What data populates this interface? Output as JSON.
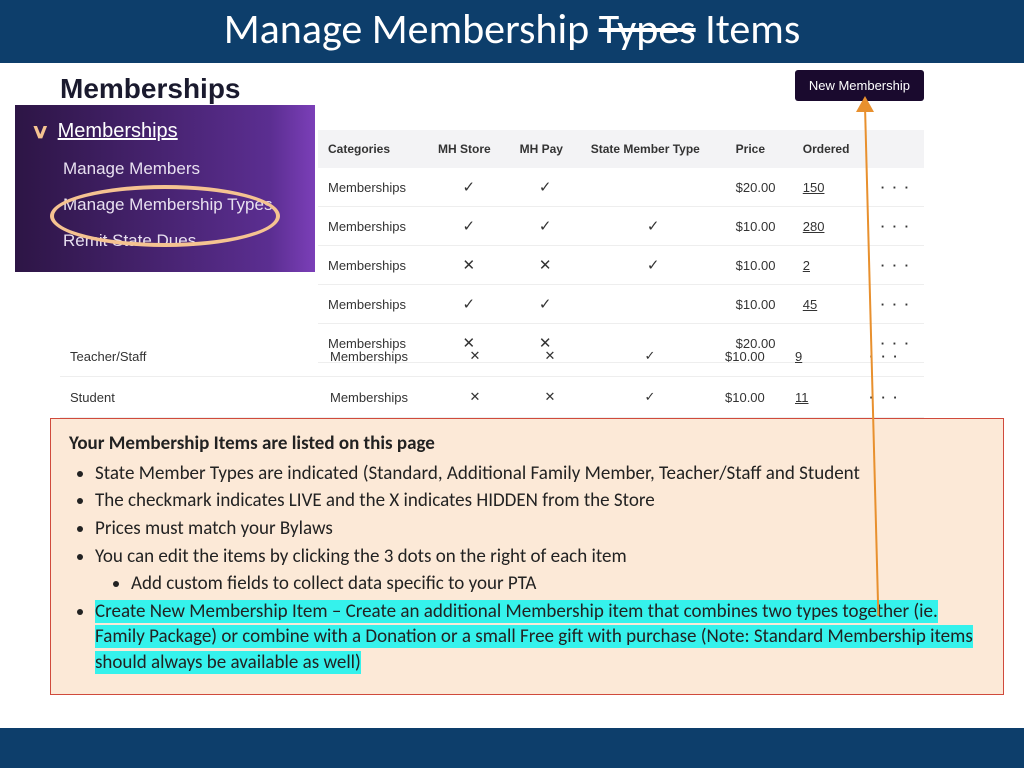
{
  "banner": {
    "prefix": "Manage Membership ",
    "strike": "Types",
    "suffix": " Items"
  },
  "app": {
    "title": "Memberships",
    "new_btn": "New Membership"
  },
  "sidebar": {
    "heading": "Memberships",
    "items": [
      "Manage Members",
      "Manage Membership Types",
      "Remit State Dues"
    ]
  },
  "table": {
    "headers": [
      "Categories",
      "MH Store",
      "MH Pay",
      "State Member Type",
      "Price",
      "Ordered"
    ],
    "rows": [
      {
        "cat": "Memberships",
        "store": "check",
        "pay": "check",
        "state": "",
        "price": "$20.00",
        "ordered": "150"
      },
      {
        "cat": "Memberships",
        "store": "check",
        "pay": "check",
        "state": "check",
        "price": "$10.00",
        "ordered": "280"
      },
      {
        "cat": "Memberships",
        "store": "x",
        "pay": "x",
        "state": "check",
        "price": "$10.00",
        "ordered": "2"
      },
      {
        "cat": "Memberships",
        "store": "check",
        "pay": "check",
        "state": "",
        "price": "$10.00",
        "ordered": "45"
      },
      {
        "cat": "Memberships",
        "store": "x",
        "pay": "x",
        "state": "",
        "price": "$20.00",
        "ordered": ""
      }
    ],
    "lower_rows": [
      {
        "name": "Teacher/Staff",
        "cat": "Memberships",
        "store": "x",
        "pay": "x",
        "state": "check",
        "price": "$10.00",
        "ordered": "9"
      },
      {
        "name": "Student",
        "cat": "Memberships",
        "store": "x",
        "pay": "x",
        "state": "check",
        "price": "$10.00",
        "ordered": "11"
      }
    ]
  },
  "icons": {
    "check": "✓",
    "x": "✕",
    "dots": "· · ·"
  },
  "notes": {
    "title": "Your Membership Items are listed on this page",
    "b1": "State Member Types are indicated (Standard, Additional Family Member, Teacher/Staff and Student",
    "b2": "The checkmark indicates LIVE and the X indicates HIDDEN from the Store",
    "b3": "Prices must match your Bylaws",
    "b4": "You can edit the items by clicking the 3 dots on the right of each item",
    "b4a": "Add custom fields to collect data specific to your PTA",
    "b5": "Create New Membership Item – Create an additional Membership item that combines two types together (ie. Family Package) or combine with a Donation or a small Free gift with purchase (Note: Standard Membership items should always be available as well)"
  }
}
